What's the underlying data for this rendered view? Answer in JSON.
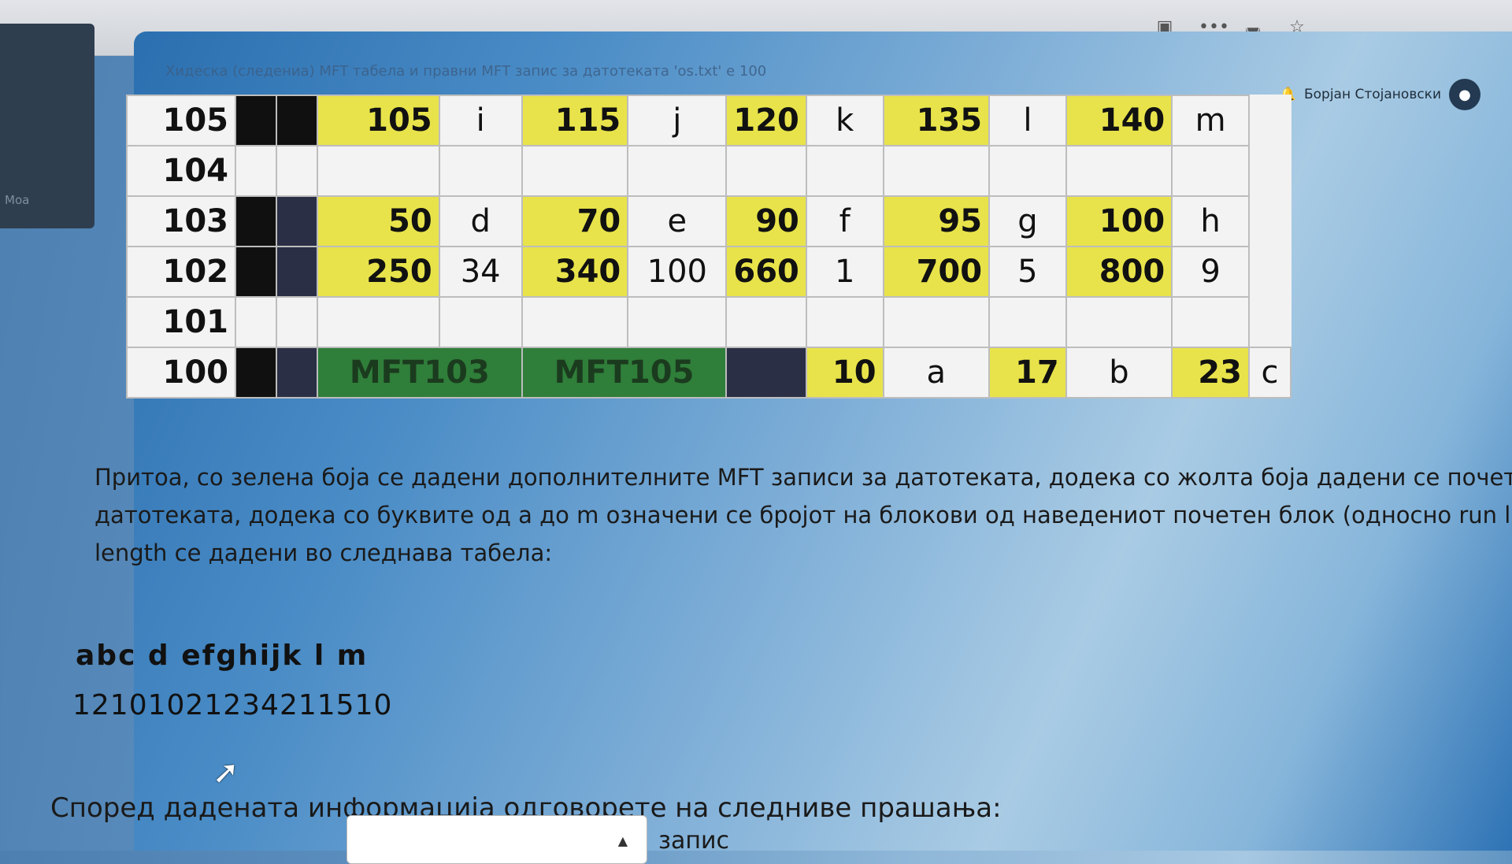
{
  "browser": {
    "toolbar_icons": [
      "reader-mode-icon",
      "more-icon",
      "pocket-icon",
      "bookmark-star-icon"
    ],
    "right_icons": [
      "library-icon",
      "sidebar-icon",
      "gear-icon"
    ]
  },
  "sidebar": {
    "label": "Moa"
  },
  "header": {
    "question_text": "Хидеска (следениа) МFТ табела и правни МFТ запис за датотеката 'os.txt' е 100",
    "user_name": "Борјан Стојановски"
  },
  "mft_table": {
    "rows": [
      {
        "block": "105",
        "cells": [
          "105",
          "i",
          "115",
          "j",
          "120",
          "k",
          "135",
          "l",
          "140",
          "m"
        ]
      },
      {
        "block": "104",
        "cells": [
          "",
          "",
          "",
          "",
          "",
          "",
          "",
          "",
          "",
          ""
        ]
      },
      {
        "block": "103",
        "cells": [
          "50",
          "d",
          "70",
          "e",
          "90",
          "f",
          "95",
          "g",
          "100",
          "h"
        ]
      },
      {
        "block": "102",
        "cells": [
          "250",
          "34",
          "340",
          "100",
          "660",
          "1",
          "700",
          "5",
          "800",
          "9"
        ]
      },
      {
        "block": "101",
        "cells": [
          "",
          "",
          "",
          "",
          "",
          "",
          "",
          "",
          "",
          ""
        ]
      },
      {
        "block": "100",
        "mft": [
          "MFT103",
          "MFT105"
        ],
        "cells": [
          "10",
          "a",
          "17",
          "b",
          "23",
          "c"
        ]
      }
    ]
  },
  "content": {
    "line1": "Притоа, со зелена боја се дадени дополнителните MFT записи за датотеката, додека со жолта боја дадени се почетните блок",
    "line2": "датотеката, додека со буквите од а до m означени се бројот на блокови од наведениот почетен блок (односно run length), ",
    "line3": "length се дадени во следнава табела:",
    "letters": "abc  d  efghijk  l m",
    "numbers": "12101021234211510",
    "prompt": "Според дадената информација одговорете на следниве прашања:",
    "field_label": "запис"
  },
  "colors": {
    "yellow": "#e8e34a",
    "green": "#2f7e3a",
    "black": "#101010"
  }
}
